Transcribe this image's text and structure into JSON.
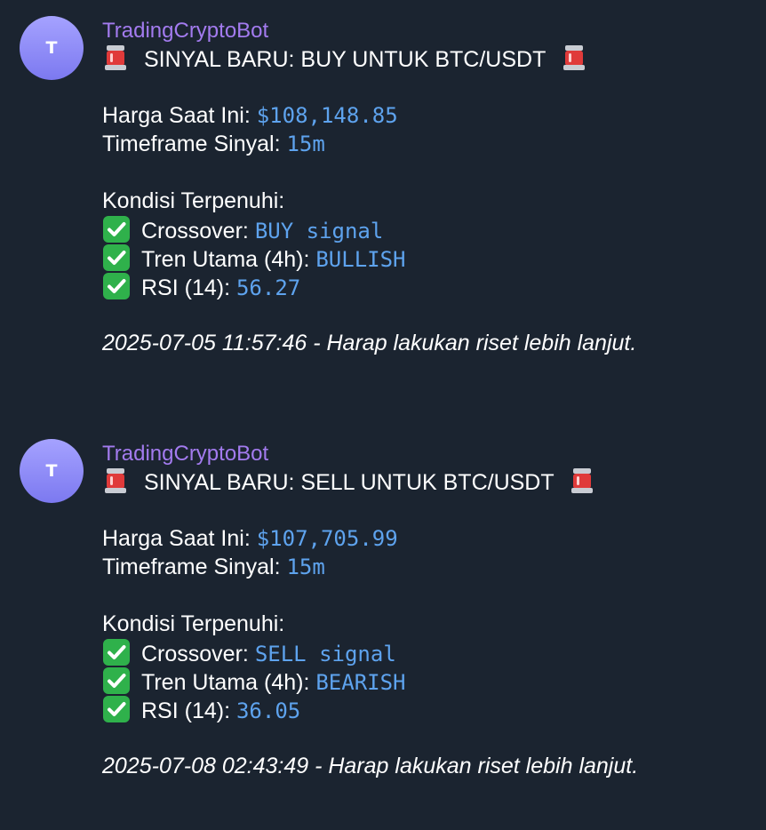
{
  "messages": [
    {
      "avatar_letter": "T",
      "sender": "TradingCryptoBot",
      "headline": "SINYAL BARU: BUY UNTUK BTC/USDT",
      "price_label": "Harga Saat Ini:",
      "price_value": "$108,148.85",
      "timeframe_label": "Timeframe Sinyal:",
      "timeframe_value": "15m",
      "conditions_title": "Kondisi Terpenuhi:",
      "conditions": [
        {
          "label": "Crossover:",
          "value": "BUY signal"
        },
        {
          "label": "Tren Utama (4h):",
          "value": "BULLISH"
        },
        {
          "label": "RSI (14):",
          "value": "56.27"
        }
      ],
      "footer": "2025-07-05 11:57:46 - Harap lakukan riset lebih lanjut."
    },
    {
      "avatar_letter": "T",
      "sender": "TradingCryptoBot",
      "headline": "SINYAL BARU: SELL UNTUK BTC/USDT",
      "price_label": "Harga Saat Ini:",
      "price_value": "$107,705.99",
      "timeframe_label": "Timeframe Sinyal:",
      "timeframe_value": "15m",
      "conditions_title": "Kondisi Terpenuhi:",
      "conditions": [
        {
          "label": "Crossover:",
          "value": "SELL signal"
        },
        {
          "label": "Tren Utama (4h):",
          "value": "BEARISH"
        },
        {
          "label": "RSI (14):",
          "value": "36.05"
        }
      ],
      "footer": "2025-07-08 02:43:49 - Harap lakukan riset lebih lanjut."
    }
  ],
  "icons": {
    "headline_emoji": "siren-icon",
    "condition_emoji": "check-mark-icon"
  },
  "colors": {
    "background": "#1b2430",
    "sender": "#a37bef",
    "value": "#5ea3ee",
    "avatar": "#8f8cf7",
    "check": "#2fb14b",
    "siren": "#e03a3a"
  }
}
